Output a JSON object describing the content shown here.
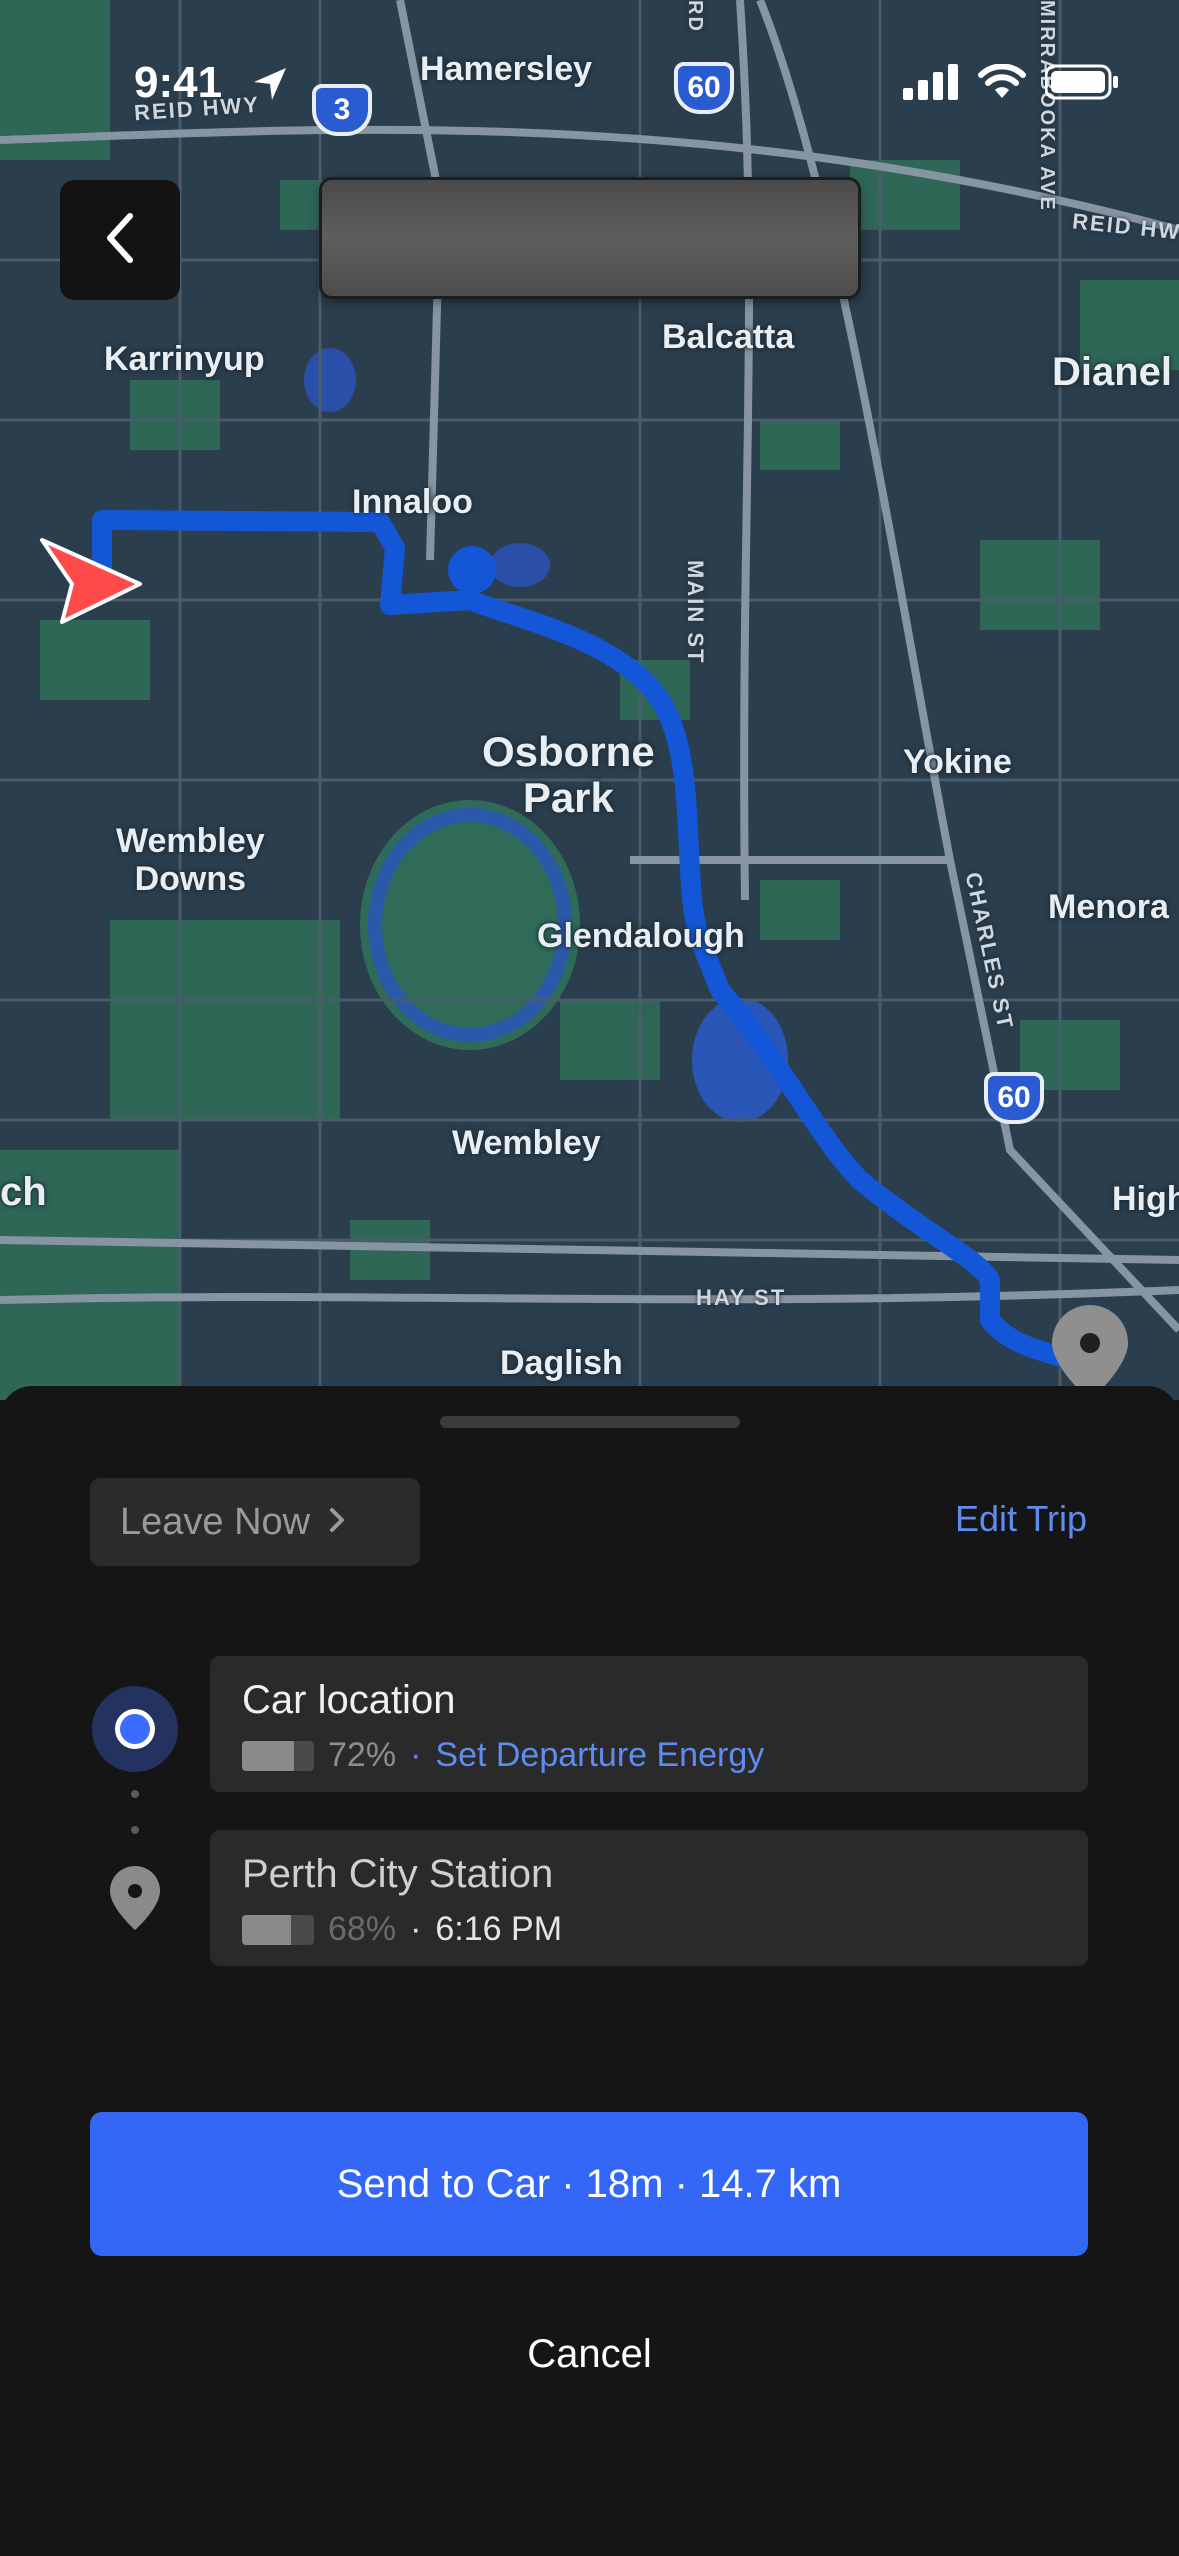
{
  "status_bar": {
    "time": "9:41"
  },
  "map": {
    "places": {
      "hamersley": "Hamersley",
      "karrinyup": "Karrinyup",
      "balcatta": "Balcatta",
      "dianella": "Dianel",
      "innaloo": "Innaloo",
      "osborne_park_1": "Osborne",
      "osborne_park_2": "Park",
      "yokine": "Yokine",
      "wembley_downs_1": "Wembley",
      "wembley_downs_2": "Downs",
      "glendalough": "Glendalough",
      "menora": "Menora",
      "wembley": "Wembley",
      "leederville_partial": "ch",
      "highgate_partial": "High",
      "daglish": "Daglish"
    },
    "streets": {
      "reid_hwy_left": "REID HWY",
      "reid_hwy_right": "REID HW",
      "main_st": "MAIN ST",
      "charles_st": "CHARLES ST",
      "hay_st": "HAY ST",
      "mirrabooka_ave": "MIRRABOOKA AVE",
      "rd_partial": "RD"
    },
    "shields": {
      "s1": "3",
      "s2": "60",
      "s3": "60"
    },
    "colors": {
      "route": "#1357d8",
      "origin_arrow": "#ff4a4a"
    }
  },
  "trip": {
    "leave_now_label": "Leave Now",
    "edit_trip_label": "Edit Trip",
    "origin": {
      "title": "Car location",
      "battery_text": "72%",
      "battery_level": 0.72,
      "separator": "·",
      "action": "Set Departure Energy"
    },
    "destination": {
      "title": "Perth City Station",
      "battery_text": "68%",
      "battery_level": 0.68,
      "separator": "·",
      "arrival": "6:16 PM"
    },
    "send_button": "Send to Car · 18m · 14.7 km",
    "cancel_button": "Cancel"
  }
}
